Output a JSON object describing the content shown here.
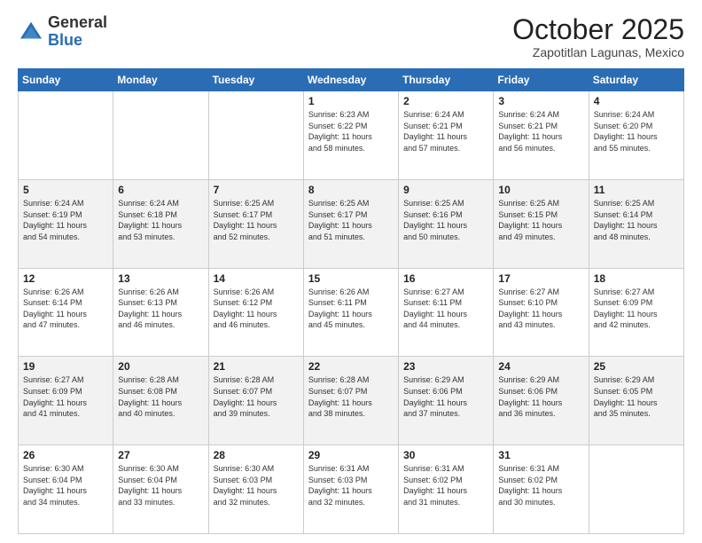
{
  "logo": {
    "general": "General",
    "blue": "Blue"
  },
  "header": {
    "month": "October 2025",
    "location": "Zapotitlan Lagunas, Mexico"
  },
  "weekdays": [
    "Sunday",
    "Monday",
    "Tuesday",
    "Wednesday",
    "Thursday",
    "Friday",
    "Saturday"
  ],
  "weeks": [
    [
      {
        "day": "",
        "info": ""
      },
      {
        "day": "",
        "info": ""
      },
      {
        "day": "",
        "info": ""
      },
      {
        "day": "1",
        "info": "Sunrise: 6:23 AM\nSunset: 6:22 PM\nDaylight: 11 hours\nand 58 minutes."
      },
      {
        "day": "2",
        "info": "Sunrise: 6:24 AM\nSunset: 6:21 PM\nDaylight: 11 hours\nand 57 minutes."
      },
      {
        "day": "3",
        "info": "Sunrise: 6:24 AM\nSunset: 6:21 PM\nDaylight: 11 hours\nand 56 minutes."
      },
      {
        "day": "4",
        "info": "Sunrise: 6:24 AM\nSunset: 6:20 PM\nDaylight: 11 hours\nand 55 minutes."
      }
    ],
    [
      {
        "day": "5",
        "info": "Sunrise: 6:24 AM\nSunset: 6:19 PM\nDaylight: 11 hours\nand 54 minutes."
      },
      {
        "day": "6",
        "info": "Sunrise: 6:24 AM\nSunset: 6:18 PM\nDaylight: 11 hours\nand 53 minutes."
      },
      {
        "day": "7",
        "info": "Sunrise: 6:25 AM\nSunset: 6:17 PM\nDaylight: 11 hours\nand 52 minutes."
      },
      {
        "day": "8",
        "info": "Sunrise: 6:25 AM\nSunset: 6:17 PM\nDaylight: 11 hours\nand 51 minutes."
      },
      {
        "day": "9",
        "info": "Sunrise: 6:25 AM\nSunset: 6:16 PM\nDaylight: 11 hours\nand 50 minutes."
      },
      {
        "day": "10",
        "info": "Sunrise: 6:25 AM\nSunset: 6:15 PM\nDaylight: 11 hours\nand 49 minutes."
      },
      {
        "day": "11",
        "info": "Sunrise: 6:25 AM\nSunset: 6:14 PM\nDaylight: 11 hours\nand 48 minutes."
      }
    ],
    [
      {
        "day": "12",
        "info": "Sunrise: 6:26 AM\nSunset: 6:14 PM\nDaylight: 11 hours\nand 47 minutes."
      },
      {
        "day": "13",
        "info": "Sunrise: 6:26 AM\nSunset: 6:13 PM\nDaylight: 11 hours\nand 46 minutes."
      },
      {
        "day": "14",
        "info": "Sunrise: 6:26 AM\nSunset: 6:12 PM\nDaylight: 11 hours\nand 46 minutes."
      },
      {
        "day": "15",
        "info": "Sunrise: 6:26 AM\nSunset: 6:11 PM\nDaylight: 11 hours\nand 45 minutes."
      },
      {
        "day": "16",
        "info": "Sunrise: 6:27 AM\nSunset: 6:11 PM\nDaylight: 11 hours\nand 44 minutes."
      },
      {
        "day": "17",
        "info": "Sunrise: 6:27 AM\nSunset: 6:10 PM\nDaylight: 11 hours\nand 43 minutes."
      },
      {
        "day": "18",
        "info": "Sunrise: 6:27 AM\nSunset: 6:09 PM\nDaylight: 11 hours\nand 42 minutes."
      }
    ],
    [
      {
        "day": "19",
        "info": "Sunrise: 6:27 AM\nSunset: 6:09 PM\nDaylight: 11 hours\nand 41 minutes."
      },
      {
        "day": "20",
        "info": "Sunrise: 6:28 AM\nSunset: 6:08 PM\nDaylight: 11 hours\nand 40 minutes."
      },
      {
        "day": "21",
        "info": "Sunrise: 6:28 AM\nSunset: 6:07 PM\nDaylight: 11 hours\nand 39 minutes."
      },
      {
        "day": "22",
        "info": "Sunrise: 6:28 AM\nSunset: 6:07 PM\nDaylight: 11 hours\nand 38 minutes."
      },
      {
        "day": "23",
        "info": "Sunrise: 6:29 AM\nSunset: 6:06 PM\nDaylight: 11 hours\nand 37 minutes."
      },
      {
        "day": "24",
        "info": "Sunrise: 6:29 AM\nSunset: 6:06 PM\nDaylight: 11 hours\nand 36 minutes."
      },
      {
        "day": "25",
        "info": "Sunrise: 6:29 AM\nSunset: 6:05 PM\nDaylight: 11 hours\nand 35 minutes."
      }
    ],
    [
      {
        "day": "26",
        "info": "Sunrise: 6:30 AM\nSunset: 6:04 PM\nDaylight: 11 hours\nand 34 minutes."
      },
      {
        "day": "27",
        "info": "Sunrise: 6:30 AM\nSunset: 6:04 PM\nDaylight: 11 hours\nand 33 minutes."
      },
      {
        "day": "28",
        "info": "Sunrise: 6:30 AM\nSunset: 6:03 PM\nDaylight: 11 hours\nand 32 minutes."
      },
      {
        "day": "29",
        "info": "Sunrise: 6:31 AM\nSunset: 6:03 PM\nDaylight: 11 hours\nand 32 minutes."
      },
      {
        "day": "30",
        "info": "Sunrise: 6:31 AM\nSunset: 6:02 PM\nDaylight: 11 hours\nand 31 minutes."
      },
      {
        "day": "31",
        "info": "Sunrise: 6:31 AM\nSunset: 6:02 PM\nDaylight: 11 hours\nand 30 minutes."
      },
      {
        "day": "",
        "info": ""
      }
    ]
  ]
}
